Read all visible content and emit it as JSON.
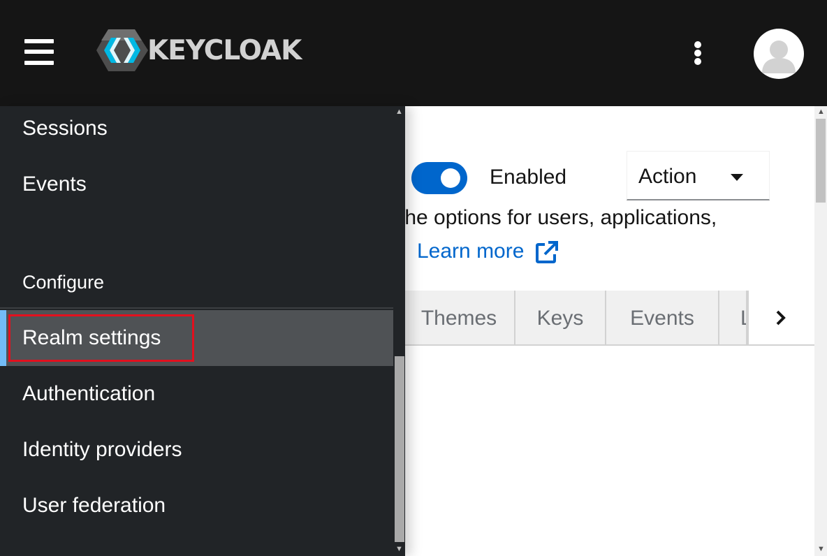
{
  "header": {
    "brand": "KEYCLOAK",
    "colors": {
      "background": "#151515",
      "logo_blue": "#00b9e4",
      "logo_gray": "#d2d2d2"
    }
  },
  "sidebar": {
    "items_top": [
      {
        "label": "Sessions"
      },
      {
        "label": "Events"
      }
    ],
    "section_title": "Configure",
    "items_configure": [
      {
        "label": "Realm settings",
        "active": true
      },
      {
        "label": "Authentication"
      },
      {
        "label": "Identity providers"
      },
      {
        "label": "User federation"
      }
    ],
    "colors": {
      "background": "#212427",
      "active": "#4f5255",
      "active_bar": "#73bcf7",
      "highlight": "#e3101e"
    }
  },
  "main": {
    "enabled_label": "Enabled",
    "enabled": true,
    "action_label": "Action",
    "description": "l the options for users, applications,",
    "learn_more": "Learn more",
    "tabs": [
      {
        "label": "Themes"
      },
      {
        "label": "Keys"
      },
      {
        "label": "Events"
      },
      {
        "label": "L"
      }
    ],
    "colors": {
      "toggle": "#0066cc",
      "link": "#0066cc",
      "tab_bg": "#f0f0f0"
    }
  }
}
